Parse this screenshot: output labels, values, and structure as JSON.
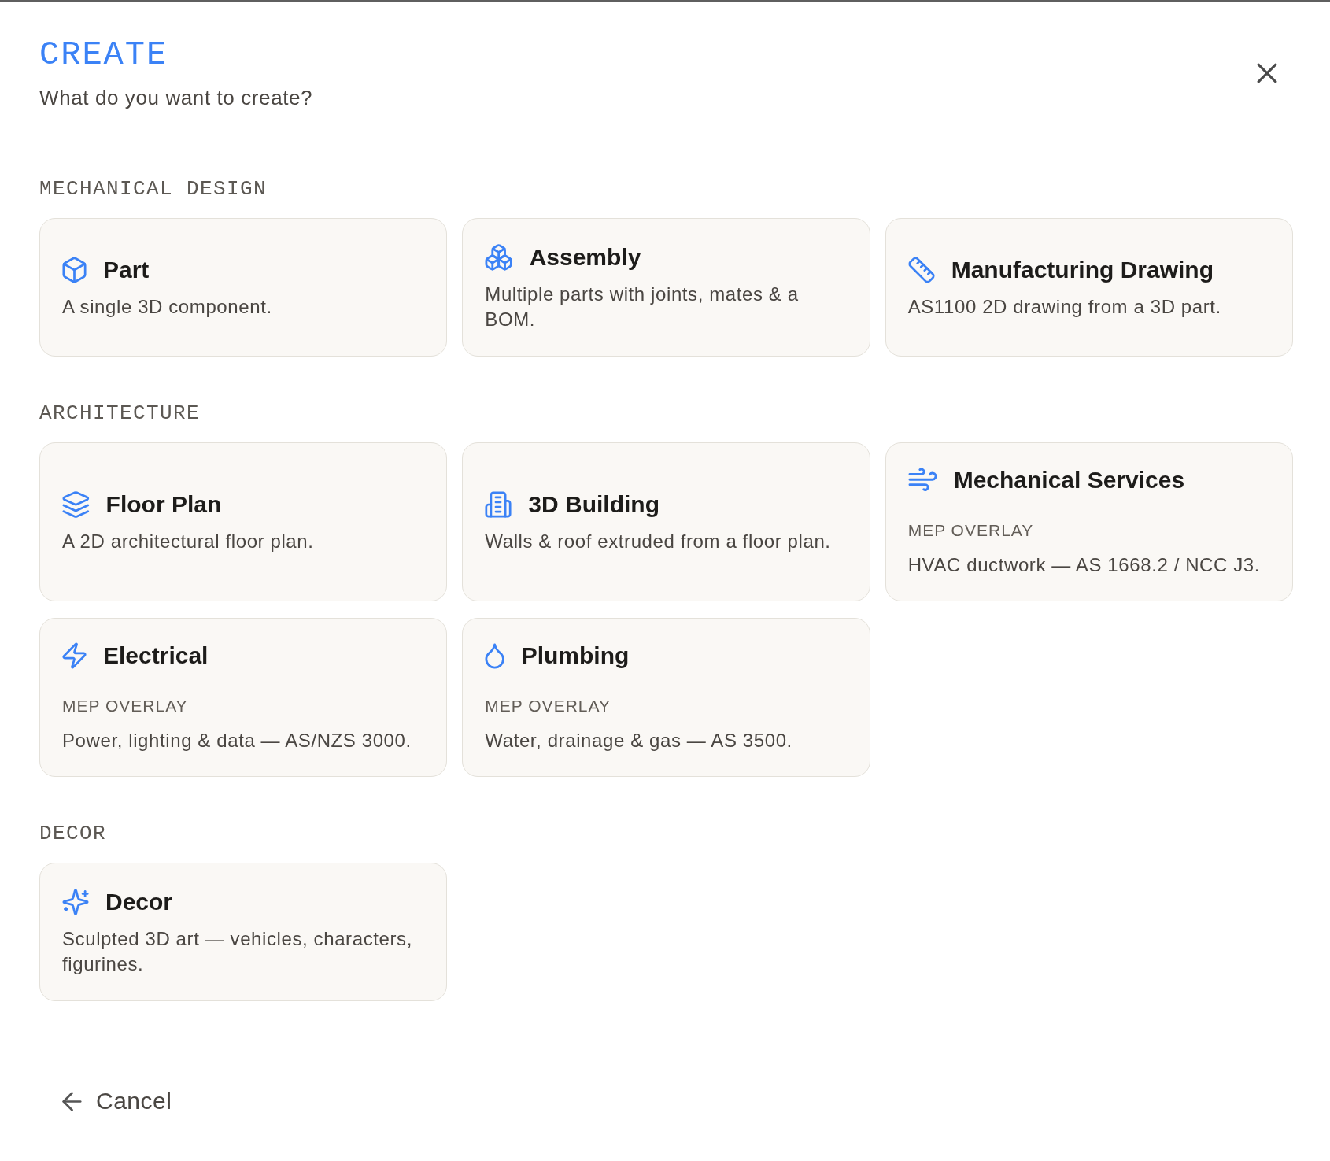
{
  "dialog": {
    "title": "CREATE",
    "subtitle": "What do you want to create?"
  },
  "sections": [
    {
      "label": "MECHANICAL DESIGN",
      "items": [
        {
          "kind": "part",
          "title": "Part",
          "description": "A single 3D component."
        },
        {
          "kind": "assembly",
          "title": "Assembly",
          "description": "Multiple parts with joints, mates & a BOM."
        },
        {
          "kind": "drawing",
          "title": "Manufacturing Drawing",
          "description": "AS1100 2D drawing from a 3D part."
        }
      ]
    },
    {
      "label": "ARCHITECTURE",
      "items": [
        {
          "kind": "floorplan",
          "title": "Floor Plan",
          "description": "A 2D architectural floor plan."
        },
        {
          "kind": "building",
          "title": "3D Building",
          "description": "Walls & roof extruded from a floor plan."
        },
        {
          "kind": "hvac",
          "title": "Mechanical Services",
          "tag": "MEP OVERLAY",
          "description": "HVAC ductwork — AS 1668.2 / NCC J3."
        },
        {
          "kind": "electrical",
          "title": "Electrical",
          "tag": "MEP OVERLAY",
          "description": "Power, lighting & data — AS/NZS 3000."
        },
        {
          "kind": "plumbing",
          "title": "Plumbing",
          "tag": "MEP OVERLAY",
          "description": "Water, drainage & gas — AS 3500."
        }
      ]
    },
    {
      "label": "DECOR",
      "items": [
        {
          "kind": "decor",
          "title": "Decor",
          "description": "Sculpted 3D art — vehicles, characters, figurines."
        }
      ]
    }
  ],
  "footer": {
    "cancel": "Cancel"
  }
}
